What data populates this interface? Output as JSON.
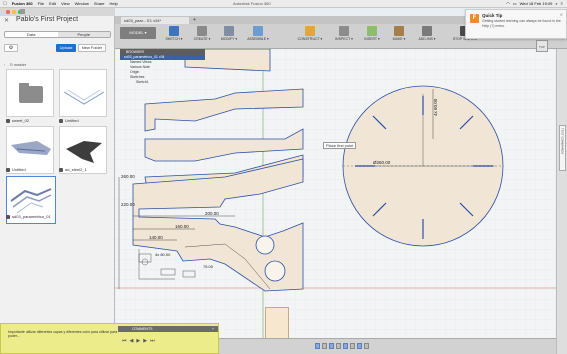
{
  "macos_menu": {
    "apple_icon": "apple-icon",
    "items": [
      "Fusion 360",
      "File",
      "Edit",
      "View",
      "Window",
      "Share",
      "Help"
    ],
    "window_title": "Autodesk Fusion 360",
    "clock": "Wed 18 Feb  19:09"
  },
  "left_panel": {
    "title": "Pablo's First Project",
    "tabs": [
      {
        "label": "Data",
        "active": true
      },
      {
        "label": "People",
        "active": false
      }
    ],
    "upload_label": "Upload",
    "new_folder_label": "New Folder",
    "branch_label": "master",
    "items": [
      {
        "label": "sweet_02"
      },
      {
        "label": "Untitled"
      },
      {
        "label": "Untitled"
      },
      {
        "label": "ad_steel2_1"
      },
      {
        "label": "sd03_parametrico_01"
      }
    ]
  },
  "toolbar": {
    "doc_tab_label": "sd03_paar...  E1  v34*",
    "workspace_label": "MODEL ▾",
    "groups": [
      {
        "label": "SKETCH ▾",
        "color": "#3e73c4"
      },
      {
        "label": "CREATE ▾",
        "color": "#8a8a8a"
      },
      {
        "label": "MODIFY ▾",
        "color": "#7f8ea3"
      },
      {
        "label": "ASSEMBLE ▾",
        "color": "#6b9dd1"
      },
      {
        "label": "CONSTRUCT ▾",
        "color": "#e6a43b"
      },
      {
        "label": "INSPECT ▾",
        "color": "#8c8c8c"
      },
      {
        "label": "INSERT ▾",
        "color": "#8dbf6b"
      },
      {
        "label": "MAKE ▾",
        "color": "#a67d4d"
      },
      {
        "label": "ADD-INS ▾",
        "color": "#7a7a7a"
      },
      {
        "label": "STOP SKETCH",
        "color": "#4a4a4a"
      }
    ]
  },
  "browser": {
    "header": "BROWSER",
    "root": "sd03_parametrico_01 v34",
    "rows": [
      "Named Views",
      "Various Note",
      "Origin",
      "Sketches",
      "Sketch1"
    ]
  },
  "canvas": {
    "tooltip": "Place first point",
    "dimensions": {
      "circle_diameter": "Ø260.00",
      "vertical_dim": "4x 60.00",
      "dim_260": "260.00",
      "dim_220": "220.00",
      "dim_200": "200.00",
      "dim_160": "160.00",
      "dim_140": "140.00",
      "dim_80": "4x 80.00",
      "dim_75": "75.00"
    },
    "viewcube_label": "TOP"
  },
  "right_strip": {
    "tab_label": "TEXT COMMANDS"
  },
  "notification": {
    "icon_letter": "F",
    "title": "Quick Tip",
    "body": "Getting started learning can always be found in the Help (?) menu."
  },
  "comments_bar": {
    "label": "COMMENTS"
  },
  "chat": {
    "text": "Importante utilizar diferentes capas y diferentes color para utilizar para poder..."
  }
}
